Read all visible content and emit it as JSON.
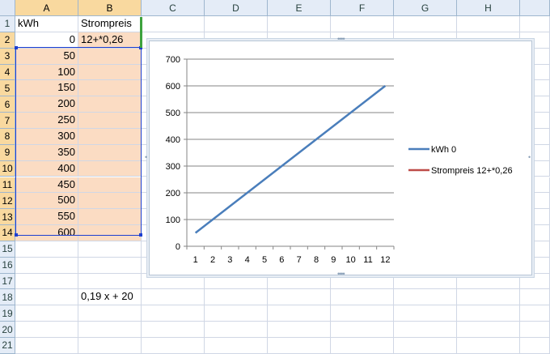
{
  "columns": [
    "A",
    "B",
    "C",
    "D",
    "E",
    "F",
    "G",
    "H"
  ],
  "rows": [
    "1",
    "2",
    "3",
    "4",
    "5",
    "6",
    "7",
    "8",
    "9",
    "10",
    "11",
    "12",
    "13",
    "14",
    "15",
    "16",
    "17",
    "18",
    "19",
    "20",
    "21"
  ],
  "cells": {
    "A1": "kWh",
    "B1": "Strompreis",
    "A2": "0",
    "B2": "12+*0,26",
    "A3": "50",
    "A4": "100",
    "A5": "150",
    "A6": "200",
    "A7": "250",
    "A8": "300",
    "A9": "350",
    "A10": "400",
    "A11": "450",
    "A12": "500",
    "A13": "550",
    "A14": "600",
    "B18": "0,19 x + 20"
  },
  "colors": {
    "selection_fill": "#fbdcc3",
    "selection_border": "#1d3fd0",
    "series_kwh": "#4a7ebb",
    "series_strompreis": "#be4b48",
    "gridline": "#868686"
  },
  "chart_data": {
    "type": "line",
    "x": [
      1,
      2,
      3,
      4,
      5,
      6,
      7,
      8,
      9,
      10,
      11,
      12
    ],
    "x_tick_labels": [
      "1",
      "2",
      "3",
      "4",
      "5",
      "6",
      "7",
      "8",
      "9",
      "10",
      "11",
      "12"
    ],
    "y_tick_labels": [
      "0",
      "100",
      "200",
      "300",
      "400",
      "500",
      "600",
      "700"
    ],
    "ylim": [
      0,
      700
    ],
    "grid": true,
    "legend_position": "right",
    "series": [
      {
        "name": "kWh 0",
        "values": [
          50,
          100,
          150,
          200,
          250,
          300,
          350,
          400,
          450,
          500,
          550,
          600
        ]
      },
      {
        "name": "Strompreis 12+*0,26",
        "values": []
      }
    ]
  }
}
